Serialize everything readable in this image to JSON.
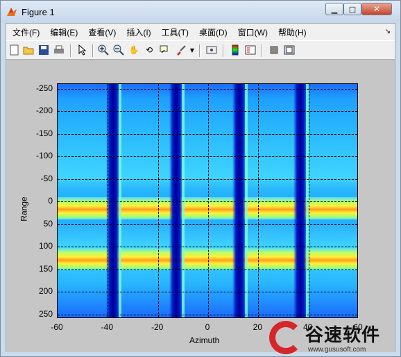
{
  "window": {
    "title": "Figure 1"
  },
  "menu": [
    "文件(F)",
    "编辑(E)",
    "查看(V)",
    "插入(I)",
    "工具(T)",
    "桌面(D)",
    "窗口(W)",
    "帮助(H)"
  ],
  "toolbar": {
    "tools": [
      "new-figure-icon",
      "open-file-icon",
      "save-icon",
      "print-icon",
      "pointer-icon",
      "zoom-in-icon",
      "zoom-out-icon",
      "pan-hand-icon",
      "rotate-3d-icon",
      "data-cursor-icon",
      "brush-icon",
      "link-plot-icon",
      "colorbar-icon",
      "legend-icon",
      "hide-plot-tools-icon",
      "show-plot-tools-icon"
    ]
  },
  "chart_data": {
    "type": "heatmap",
    "xlabel": "Azimuth",
    "ylabel": "Range",
    "xlim": [
      -60,
      60
    ],
    "ylim": [
      -260,
      260
    ],
    "y_reversed": true,
    "x_ticks": [
      -60,
      -40,
      -20,
      0,
      20,
      40,
      60
    ],
    "y_ticks": [
      -250,
      -200,
      -150,
      -100,
      -50,
      0,
      50,
      100,
      150,
      200,
      250
    ],
    "x_tick_labels": [
      "-60",
      "-40",
      "-20",
      "0",
      "20",
      "40",
      "60"
    ],
    "y_tick_labels": [
      "-250",
      "-200",
      "-150",
      "-100",
      "-50",
      "0",
      "50",
      "100",
      "150",
      "200",
      "250"
    ],
    "grid": true,
    "colormap": "jet",
    "bright_range_rows": [
      15,
      130
    ],
    "dark_azimuth_columns": [
      -38,
      -12,
      12,
      37
    ]
  },
  "watermark": {
    "text": "谷速软件",
    "url": "www.gususoft.com"
  }
}
